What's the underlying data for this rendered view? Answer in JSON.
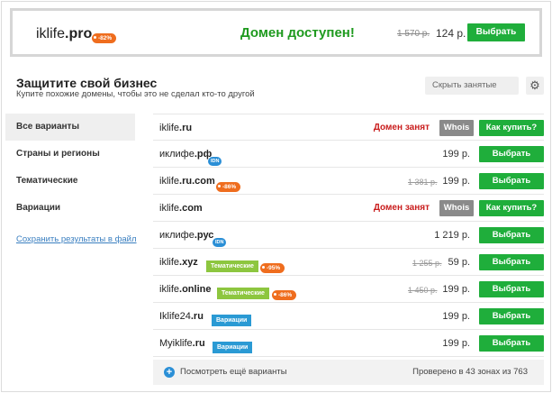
{
  "hero": {
    "domain_name": "iklife",
    "domain_zone": ".pro",
    "discount": "-82%",
    "status": "Домен доступен!",
    "old_price": "1 570 р.",
    "price": "124 р.",
    "button": "Выбрать"
  },
  "section": {
    "title": "Защитите свой бизнес",
    "subtitle": "Купите похожие домены, чтобы это не сделал кто-то другой",
    "hide_taken": "Скрыть занятые"
  },
  "menu": {
    "items": [
      "Все варианты",
      "Страны и регионы",
      "Тематические",
      "Вариации"
    ],
    "save_link": "Сохранить результаты в файл"
  },
  "labels": {
    "taken": "Домен занят",
    "whois": "Whois",
    "how_to_buy": "Как купить?",
    "choose": "Выбрать",
    "idn": "IDN",
    "thematic": "Тематические",
    "variation": "Вариации"
  },
  "rows": [
    {
      "name": "iklife",
      "zone": ".ru",
      "status": "taken"
    },
    {
      "name": "иклифе",
      "zone": ".рф",
      "idn": true,
      "price": "199 р."
    },
    {
      "name": "iklife",
      "zone": ".ru.com",
      "discount": "-86%",
      "old_price": "1 381 р.",
      "price": "199 р."
    },
    {
      "name": "iklife",
      "zone": ".com",
      "status": "taken"
    },
    {
      "name": "иклифе",
      "zone": ".рус",
      "idn": true,
      "price": "1 219 р."
    },
    {
      "name": "iklife",
      "zone": ".xyz",
      "thematic": true,
      "discount": "-95%",
      "old_price": "1 255 р.",
      "price": "59 р."
    },
    {
      "name": "iklife",
      "zone": ".online",
      "thematic": true,
      "discount": "-86%",
      "old_price": "1 450 р.",
      "price": "199 р."
    },
    {
      "name": "Iklife24",
      "zone": ".ru",
      "variation": true,
      "price": "199 р."
    },
    {
      "name": "Myiklife",
      "zone": ".ru",
      "variation": true,
      "price": "199 р."
    }
  ],
  "footer": {
    "more": "Посмотреть ещё варианты",
    "checked": "Проверено в 43 зонах из 763"
  },
  "colors": {
    "green": "#1fae3b",
    "taken_red": "#c91d1d",
    "discount_orange": "#ef6d1e",
    "idn_blue": "#2b8fd6"
  }
}
